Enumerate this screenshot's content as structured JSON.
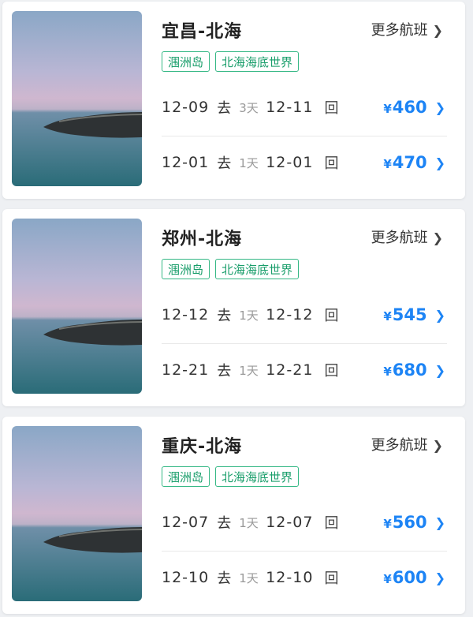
{
  "cards": [
    {
      "route": "宜昌-北海",
      "more_label": "更多航班",
      "tags": [
        "涠洲岛",
        "北海海底世界"
      ],
      "flights": [
        {
          "depart": "12-09",
          "go": "去",
          "days": "3天",
          "return": "12-11",
          "back": "回",
          "currency": "¥",
          "price": "460"
        },
        {
          "depart": "12-01",
          "go": "去",
          "days": "1天",
          "return": "12-01",
          "back": "回",
          "currency": "¥",
          "price": "470"
        }
      ]
    },
    {
      "route": "郑州-北海",
      "more_label": "更多航班",
      "tags": [
        "涠洲岛",
        "北海海底世界"
      ],
      "flights": [
        {
          "depart": "12-12",
          "go": "去",
          "days": "1天",
          "return": "12-12",
          "back": "回",
          "currency": "¥",
          "price": "545"
        },
        {
          "depart": "12-21",
          "go": "去",
          "days": "1天",
          "return": "12-21",
          "back": "回",
          "currency": "¥",
          "price": "680"
        }
      ]
    },
    {
      "route": "重庆-北海",
      "more_label": "更多航班",
      "tags": [
        "涠洲岛",
        "北海海底世界"
      ],
      "flights": [
        {
          "depart": "12-07",
          "go": "去",
          "days": "1天",
          "return": "12-07",
          "back": "回",
          "currency": "¥",
          "price": "560"
        },
        {
          "depart": "12-10",
          "go": "去",
          "days": "1天",
          "return": "12-10",
          "back": "回",
          "currency": "¥",
          "price": "600"
        }
      ]
    }
  ],
  "icons": {
    "chevron": "chevron-right-icon"
  },
  "colors": {
    "price": "#1d84f5",
    "tag": "#1a9e6b",
    "tag_border": "#35b885"
  }
}
